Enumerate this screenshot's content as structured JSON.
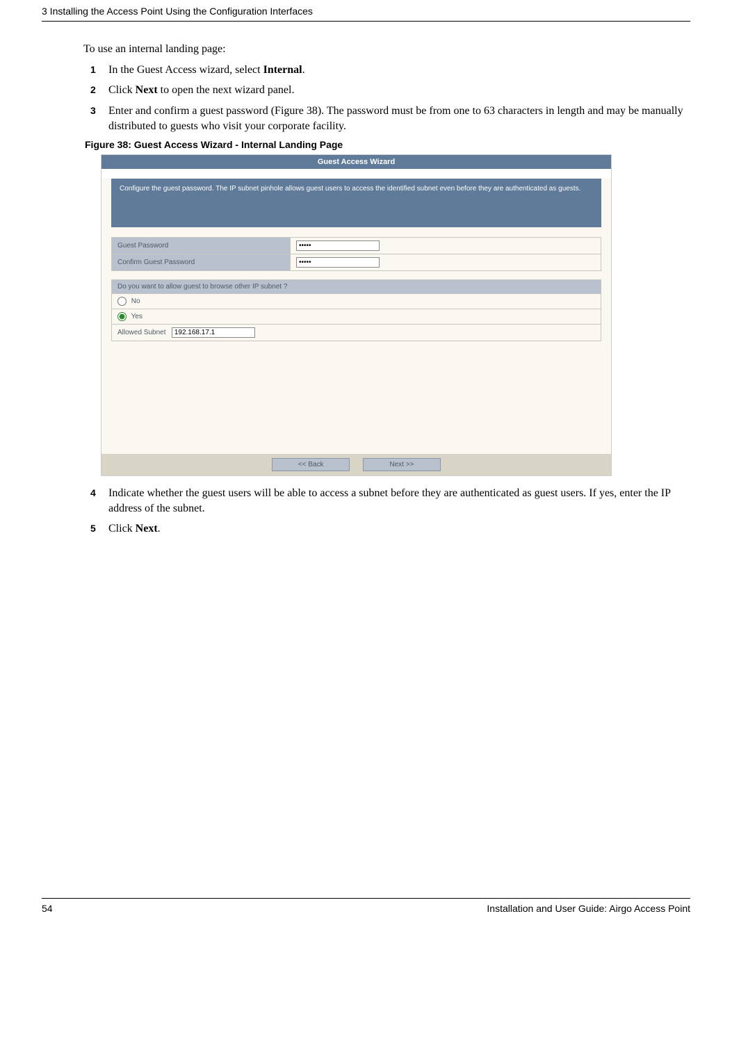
{
  "header": {
    "chapter": "3  Installing the Access Point Using the Configuration Interfaces"
  },
  "intro": "To use an internal landing page:",
  "steps_part1": [
    {
      "num": "1",
      "pre": "In the Guest Access wizard, select ",
      "bold": "Internal",
      "post": "."
    },
    {
      "num": "2",
      "pre": "Click ",
      "bold": "Next",
      "post": " to open the next wizard panel."
    },
    {
      "num": "3",
      "pre": "Enter and confirm a guest password (Figure 38). The password must be from one to 63 characters in length and may be manually distributed to guests who visit your corporate facility.",
      "bold": "",
      "post": ""
    }
  ],
  "figure_caption": "Figure 38:      Guest Access Wizard - Internal Landing Page",
  "wizard": {
    "title": "Guest Access Wizard",
    "description": "Configure the guest password. The IP subnet pinhole allows guest users to access the identified subnet even before they are authenticated as guests.",
    "fields": {
      "guest_password_label": "Guest Password",
      "guest_password_value": "•••••",
      "confirm_guest_password_label": "Confirm Guest Password",
      "confirm_guest_password_value": "•••••"
    },
    "browse_question": "Do you want to allow guest to browse other IP subnet ?",
    "options": {
      "no_label": "No",
      "yes_label": "Yes"
    },
    "allowed_subnet_label": "Allowed Subnet",
    "allowed_subnet_value": "192.168.17.1",
    "buttons": {
      "back": "<< Back",
      "next": "Next >>"
    }
  },
  "steps_part2": [
    {
      "num": "4",
      "pre": "Indicate whether the guest users will be able to access a subnet before they are authenticated as guest users. If yes, enter the IP address of the subnet.",
      "bold": "",
      "post": ""
    },
    {
      "num": "5",
      "pre": "Click ",
      "bold": "Next",
      "post": "."
    }
  ],
  "footer": {
    "page_number": "54",
    "doc_title": "Installation and User Guide: Airgo Access Point"
  }
}
